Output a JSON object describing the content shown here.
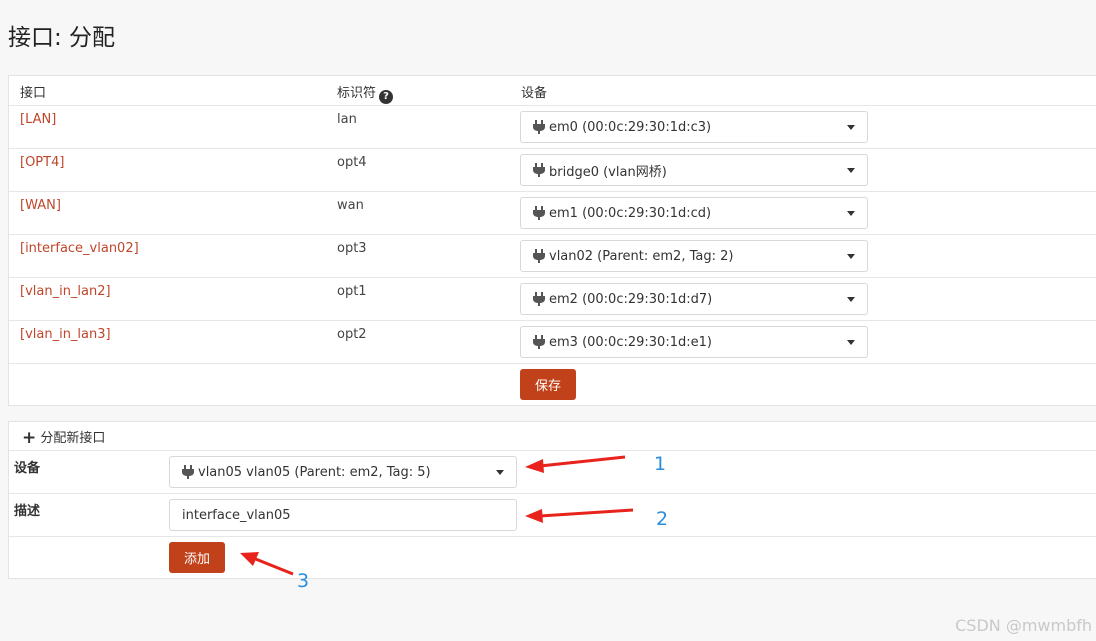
{
  "page": {
    "title": "接口: 分配"
  },
  "table": {
    "headers": {
      "interface": "接口",
      "identifier": "标识符",
      "device": "设备"
    },
    "rows": [
      {
        "interface": "[LAN]",
        "identifier": "lan",
        "device": "em0 (00:0c:29:30:1d:c3)"
      },
      {
        "interface": "[OPT4]",
        "identifier": "opt4",
        "device": "bridge0 (vlan网桥)"
      },
      {
        "interface": "[WAN]",
        "identifier": "wan",
        "device": "em1 (00:0c:29:30:1d:cd)"
      },
      {
        "interface": "[interface_vlan02]",
        "identifier": "opt3",
        "device": "vlan02 (Parent: em2, Tag: 2)"
      },
      {
        "interface": "[vlan_in_lan2]",
        "identifier": "opt1",
        "device": "em2 (00:0c:29:30:1d:d7)"
      },
      {
        "interface": "[vlan_in_lan3]",
        "identifier": "opt2",
        "device": "em3 (00:0c:29:30:1d:e1)"
      }
    ],
    "save_label": "保存"
  },
  "assign": {
    "section_title": "分配新接口",
    "device_label": "设备",
    "device_value": "vlan05 vlan05 (Parent: em2, Tag: 5)",
    "description_label": "描述",
    "description_value": "interface_vlan05",
    "add_label": "添加"
  },
  "annotations": {
    "n1": "1",
    "n2": "2",
    "n3": "3"
  },
  "watermark": "CSDN @mwmbfh",
  "colors": {
    "accent": "#c1421a",
    "link": "#c0462b",
    "annotation": "#2a8de0",
    "arrow": "#e8231c"
  }
}
